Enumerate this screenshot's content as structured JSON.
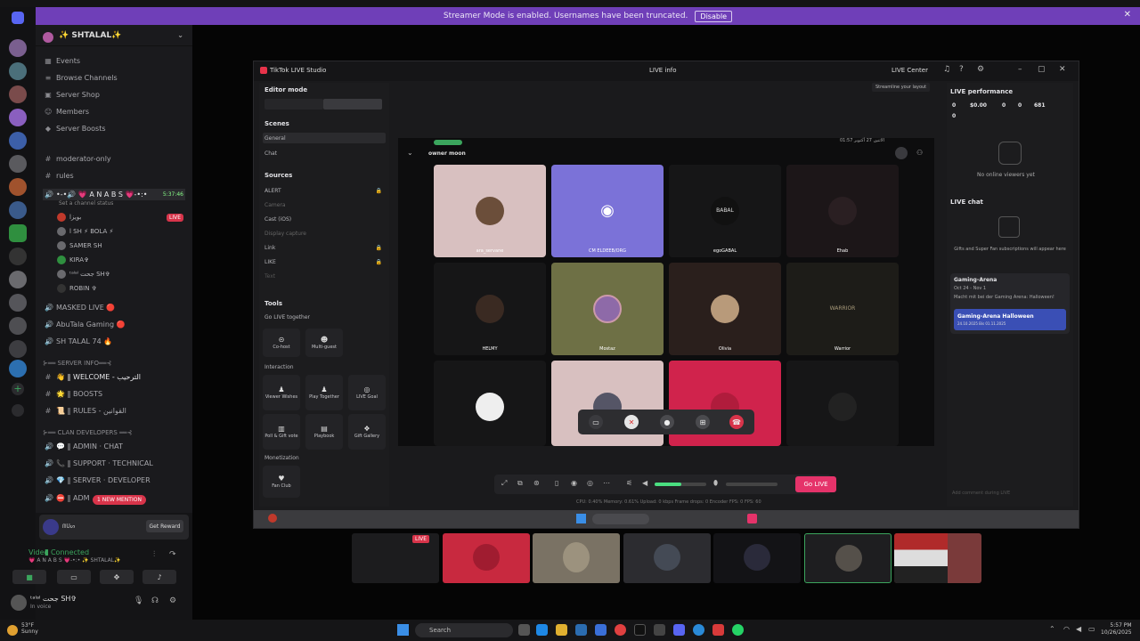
{
  "banner": {
    "text": "Streamer Mode is enabled. Usernames have been truncated.",
    "disable": "Disable",
    "close": "✕"
  },
  "server": {
    "name": "✨ SHTALAL✨"
  },
  "nav": [
    "Events",
    "Browse Channels",
    "Server Shop",
    "Members",
    "Server Boosts"
  ],
  "channels": {
    "moderator": "moderator-only",
    "rules": "rules",
    "voice_main": "•-•🔊 💗 A N A  B S 💗-•:•",
    "voice_time": "5:37:46",
    "voice_status": "Set a channel status",
    "live": "LIVE",
    "users": [
      "بويزا",
      "ا SH ⚡ BOLA ⚡",
      "SAMER SH",
      "KIRA✞",
      "ᵗᵃˡᵃˡ جحت SH✞",
      "ROBIN ✞"
    ],
    "masked": "MASKED LIVE 🔴",
    "abutala": "AbuTala Gaming 🔴",
    "shtalal74": "SH TALAL 74 🔥",
    "cat_info": "⊱══ SERVER INFO══⊰",
    "welcome": "👋 ‖ WELCOME - الترحيب",
    "boosts": "🌟 ‖ BOOSTS",
    "rules2": "📜 ‖ RULES - القوانين",
    "cat_clan": "⊱══ CLAN DEVELOPERS ══⊰",
    "admin_chat": "💬 ‖ ADMIN · CHAT",
    "support": "📞 ‖ SUPPORT · TECHNICAL",
    "server_dev": "💎 ‖ SERVER · DEVELOPER",
    "admin2": "⛔ ‖ ADM",
    "mention": "1 NEW MENTION"
  },
  "user_panel": {
    "promo": "ᗰᑌᔕ",
    "get_reward": "Get Reward",
    "video_connected": "Video Connected",
    "vc_channel": "💗 A N A  B S 💗-•:• ✨ SHTALAL✨",
    "username": "ᵗᵃˡᵃˡ جحت SH✞",
    "status": "In voice"
  },
  "tiktok": {
    "title": "TikTok LIVE Studio",
    "live_info": "LIVE info",
    "live_center": "LIVE Center",
    "editor_mode": "Editor mode",
    "scenes": "Scenes",
    "scene_items": [
      "General",
      "Chat"
    ],
    "sources": "Sources",
    "source_items": [
      "ALERT",
      "Camera",
      "Cast (iOS)",
      "Display capture",
      "Link",
      "LIKE",
      "Text"
    ],
    "tools": "Tools",
    "go_live_together": "Go LIVE together",
    "cohost": "Co-host",
    "multiguest": "Multi-guest",
    "interaction": "Interaction",
    "viewer_wishes": "Viewer Wishes",
    "play_together": "Play Together",
    "live_goal": "LIVE Goal",
    "poll": "Poll & Gift vote",
    "playbook": "Playbook",
    "gift_gallery": "Gift Gallery",
    "monetization": "Monetization",
    "fan_club": "Fan Club",
    "streamline": "Streamline your layout",
    "owner": "owner moon",
    "phone_time": "الاثنين 27 أكتوبر  01:57",
    "tiles": [
      "ara_servane",
      "CM ELDEEB/ORG",
      "egoGABAL",
      "Ehab",
      "HELMY",
      "Mostaz",
      "Olivia",
      "Warrior"
    ],
    "tile_center_text": [
      "BABAL",
      "WARRIOR"
    ],
    "go_live": "Go LIVE",
    "stats": "CPU: 0.40%   Memory: 0.61%   Upload: 0 kbps   Frame drops: 0   Encoder FPS: 0   FPS: 60",
    "perf_title": "LIVE performance",
    "perf_values": [
      "0",
      "$0.00",
      "0",
      "0",
      "681",
      "0"
    ],
    "no_viewers": "No online viewers yet",
    "chat_title": "LIVE chat",
    "chat_empty": "Gifts and Super Fan subscriptions will appear here",
    "event_title": "Gaming-Arena",
    "event_date": "Oct 24 - Nov 1",
    "event_desc": "Macht mit bei der Gaming Arena: Halloween!",
    "event_banner": "Gaming-Arena Halloween",
    "event_banner_sub": "24.10.2025 Bis 01.11.2025",
    "chat_placeholder": "Add comment during LIVE"
  },
  "taskbar": {
    "search": "Search",
    "temp": "53°F",
    "weather": "Sunny",
    "time": "5:57 PM",
    "date": "10/26/2025"
  },
  "colors": {
    "discord_purple": "#6f3fb8",
    "live_red": "#d8344a",
    "golive_pink": "#e5336a",
    "voice_green": "#3ba55d"
  }
}
